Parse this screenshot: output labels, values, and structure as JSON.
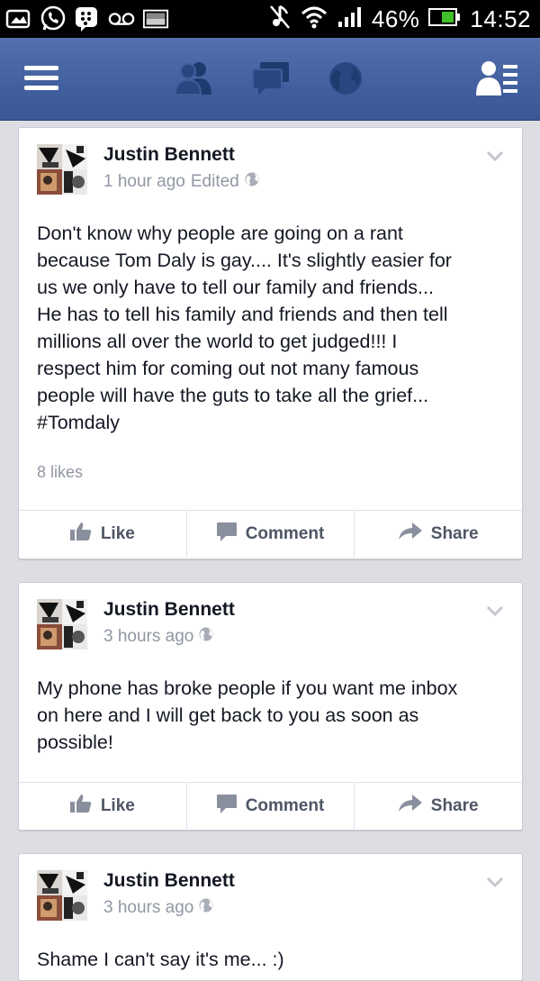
{
  "status_bar": {
    "battery_text": "46%",
    "time": "14:52",
    "icons": [
      "picture-message-icon",
      "whatsapp-icon",
      "bbm-icon",
      "voicemail-icon",
      "gallery-icon",
      "mute-icon",
      "wifi-icon",
      "signal-icon",
      "battery-icon"
    ]
  },
  "nav": {
    "icons": [
      "menu-icon",
      "friend-requests-icon",
      "messages-icon",
      "notifications-globe-icon",
      "contacts-icon"
    ]
  },
  "actions": {
    "like": "Like",
    "comment": "Comment",
    "share": "Share"
  },
  "posts": [
    {
      "author": "Justin Bennett",
      "time": "1 hour ago",
      "edited": "Edited",
      "text": "Don't know why people are going on a rant\nbecause Tom Daly is gay.... It's slightly easier for\nus we only have to tell our family and friends...\nHe has to tell his family and friends and then tell\nmillions all over the world to get judged!!! I\nrespect him for coming out not many famous\npeople will have the guts to take all the grief...\n#Tomdaly",
      "likes": "8 likes"
    },
    {
      "author": "Justin Bennett",
      "time": "3 hours ago",
      "text": "My phone has broke people if you want me inbox\non here and I will get back to you as soon as\npossible!"
    },
    {
      "author": "Justin Bennett",
      "time": "3 hours ago",
      "text": "Shame I can't say it's me... :)"
    }
  ],
  "colors": {
    "fb_blue": "#3f5d9c",
    "text": "#141823",
    "meta": "#9197a3",
    "action": "#4e5665"
  }
}
